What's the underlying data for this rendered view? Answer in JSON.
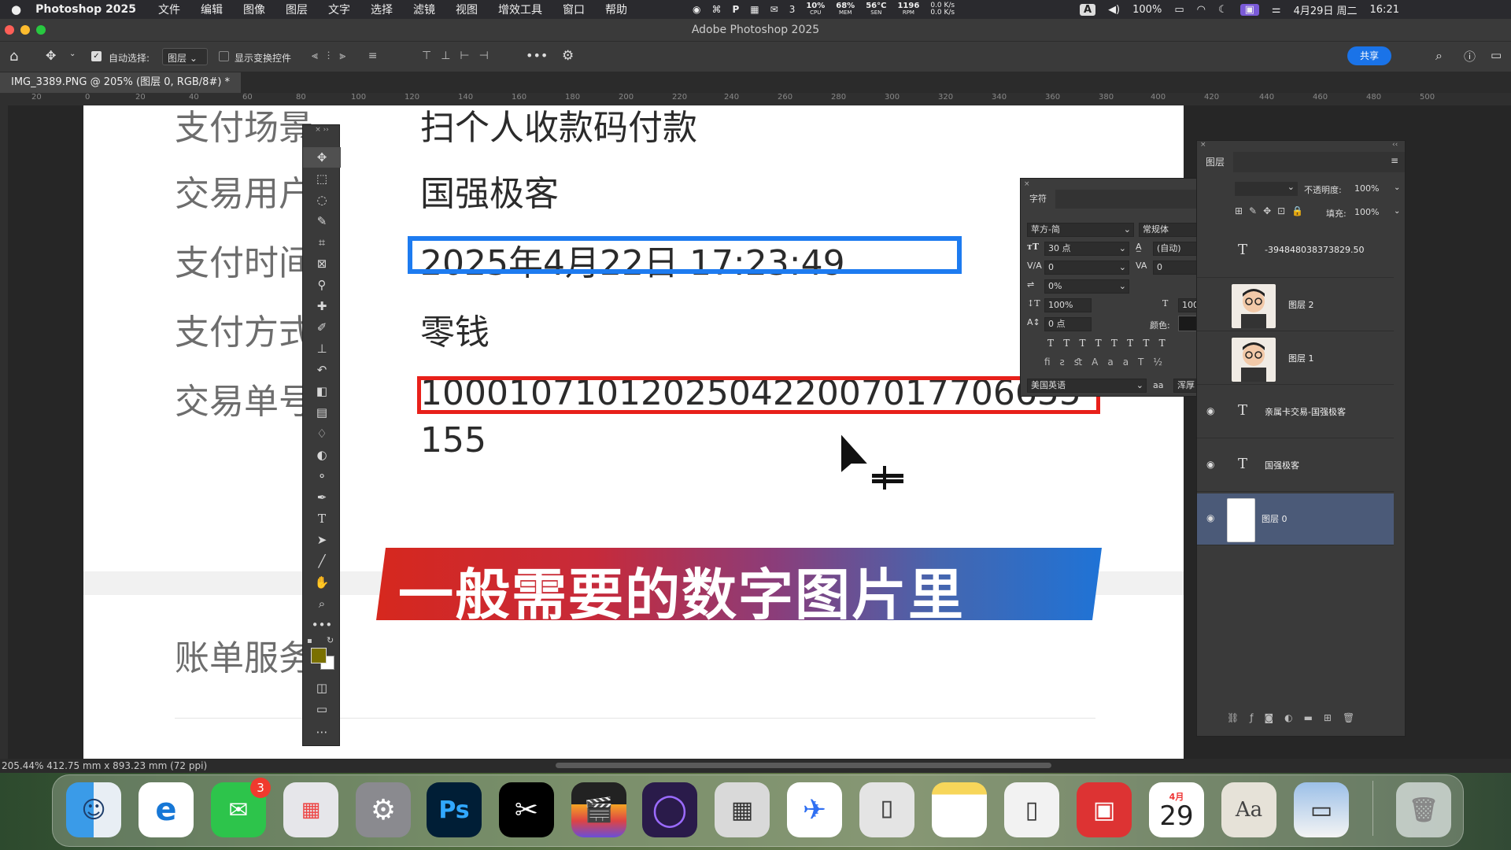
{
  "menubar": {
    "app": "Photoshop 2025",
    "items": [
      "文件",
      "编辑",
      "图像",
      "图层",
      "文字",
      "选择",
      "滤镜",
      "视图",
      "增效工具",
      "窗口",
      "帮助"
    ],
    "status": {
      "wechat_count": "3",
      "cpu": "10%",
      "cpu_label": "CPU",
      "mem": "68%",
      "mem_label": "MEM",
      "temp": "56°C",
      "temp_label": "SEN",
      "rpm": "1196",
      "rpm_label": "RPM",
      "net_up": "0.0 K/s",
      "net_down": "0.0 K/s",
      "input": "A",
      "battery": "100%",
      "date": "4月29日 周二",
      "time": "16:21"
    }
  },
  "window": {
    "title": "Adobe Photoshop 2025"
  },
  "options_bar": {
    "auto_select_label": "自动选择:",
    "auto_select_value": "图层",
    "show_transform_label": "显示变换控件",
    "share_button": "共享"
  },
  "document_tab": "IMG_3389.PNG @ 205% (图层 0, RGB/8#) *",
  "ruler_ticks": [
    "20",
    "0",
    "20",
    "40",
    "60",
    "80",
    "100",
    "120",
    "140",
    "160",
    "180",
    "200",
    "220",
    "240",
    "260",
    "280",
    "300",
    "320",
    "340",
    "360",
    "380",
    "400",
    "420",
    "440",
    "460",
    "480",
    "500"
  ],
  "canvas": {
    "labels": [
      "支付场景",
      "交易用户",
      "支付时间",
      "支付方式",
      "交易单号",
      "账单服务"
    ],
    "values": {
      "scene": "扫个人收款码付款",
      "user": "国强极客",
      "time": "2025年4月22日 17:23:49",
      "method": "零钱",
      "order_line1": "100010710120250422007017706655",
      "order_line2": "155"
    },
    "banner": "一般需要的数字图片里"
  },
  "character_panel": {
    "title": "字符",
    "font_family": "苹方-简",
    "font_style": "常规体",
    "size": "30 点",
    "leading": "(自动)",
    "kerning": "0",
    "tracking": "0",
    "scale_pct": "0%",
    "vertical_scale": "100%",
    "horizontal_scale": "100%",
    "baseline": "0 点",
    "color_label": "颜色:",
    "language": "美国英语",
    "antialias_icon": "aa",
    "antialias": "浑厚"
  },
  "layers_panel": {
    "title": "图层",
    "opacity_label": "不透明度:",
    "opacity": "100%",
    "fill_label": "填充:",
    "fill": "100%",
    "layers": [
      {
        "name": "-394848038373829.50",
        "type": "text",
        "visible": false
      },
      {
        "name": "图层 2",
        "type": "image",
        "visible": false
      },
      {
        "name": "图层 1",
        "type": "image",
        "visible": false
      },
      {
        "name": "亲属卡交易-国强极客",
        "type": "text",
        "visible": true
      },
      {
        "name": "国强极客",
        "type": "text",
        "visible": true
      },
      {
        "name": "图层 0",
        "type": "image",
        "visible": true,
        "selected": true
      }
    ]
  },
  "status_bar": {
    "text": "205.44%  412.75 mm x 893.23 mm (72 ppi)"
  },
  "dock": {
    "apps": [
      "Finder",
      "Edge",
      "WeChat",
      "Launchpad",
      "System Settings",
      "Photoshop",
      "CapCut",
      "Final Cut Pro",
      "Screen Recorder",
      "Calculator",
      "Feishu",
      "Screenshot",
      "Notes",
      "iPhone Mirroring",
      "Remote Desktop",
      "Calendar",
      "Dictionary",
      "Preview",
      "Trash"
    ],
    "wechat_badge": "3",
    "ps_label": "Ps",
    "calendar_month": "4月",
    "calendar_day": "29"
  }
}
